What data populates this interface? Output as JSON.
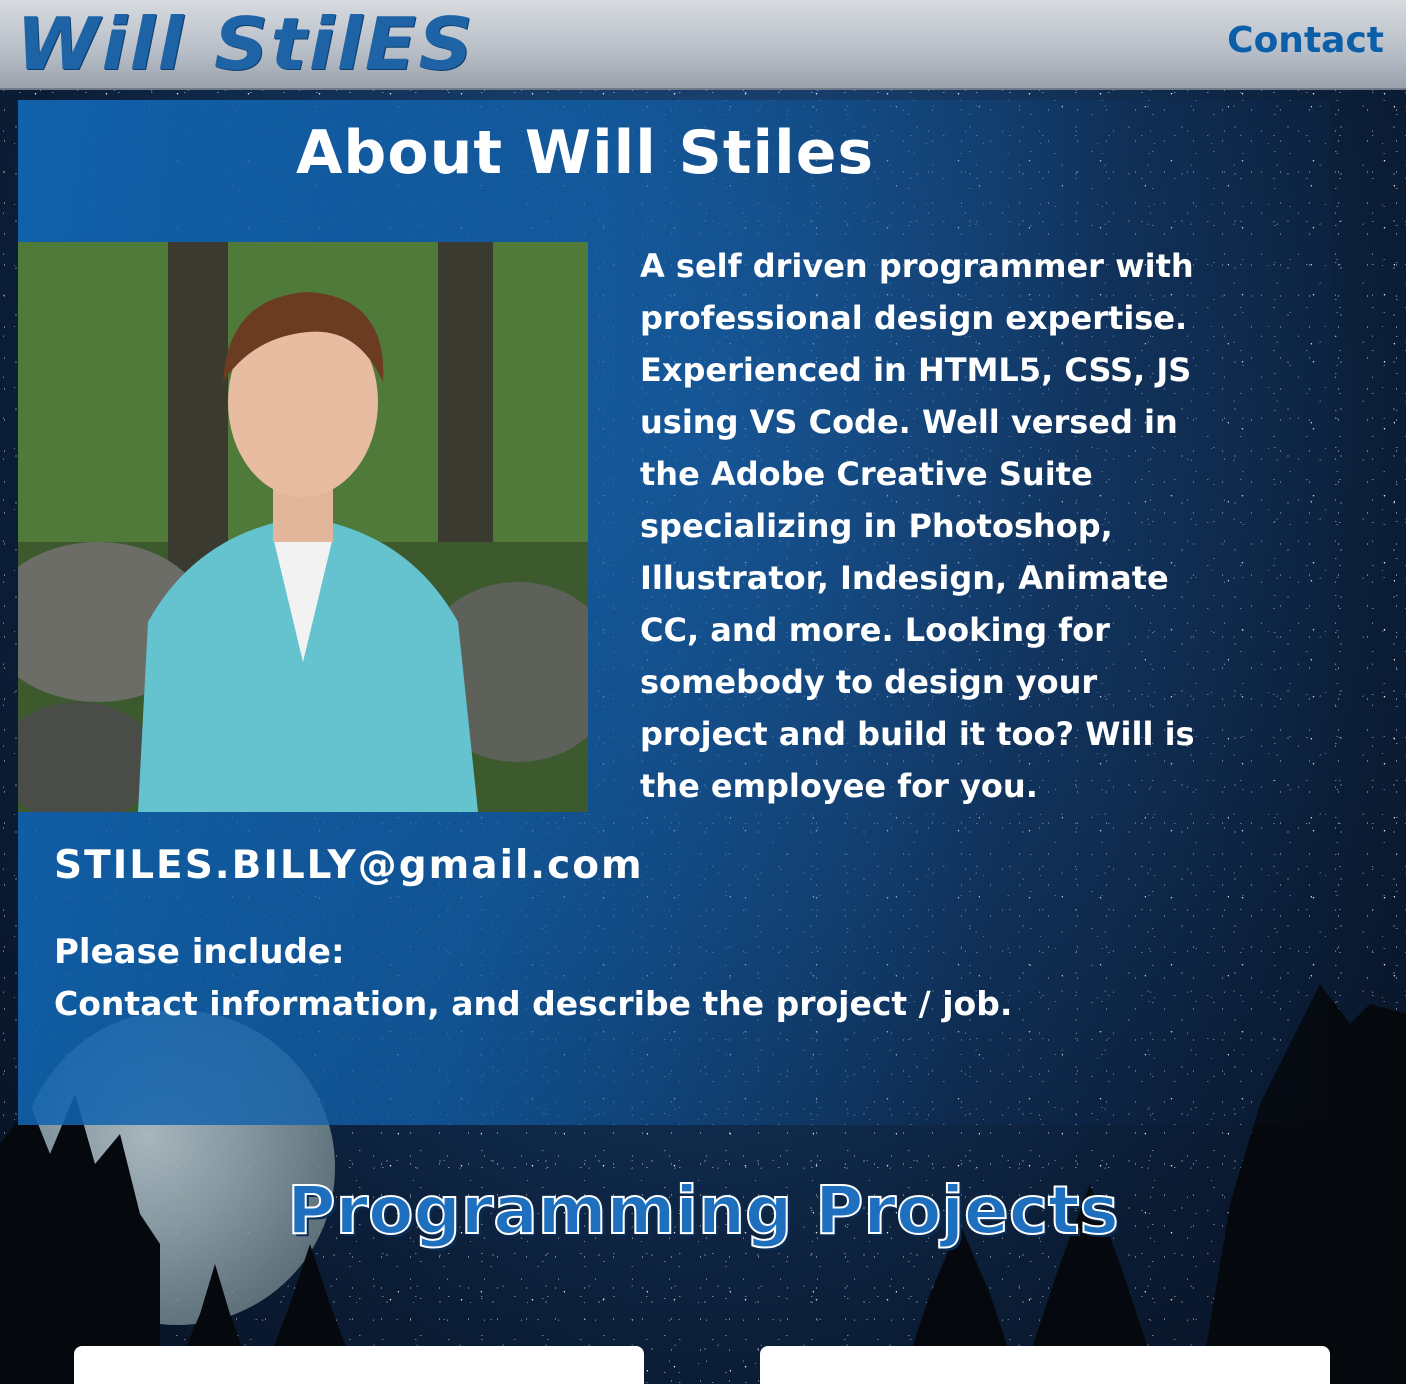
{
  "header": {
    "logo_text": "Will StilES",
    "nav_contact": "Contact"
  },
  "about": {
    "title": "About Will Stiles",
    "photo": "portrait-photo",
    "bio": "A self driven programmer with professional design expertise. Experienced in HTML5, CSS, JS using VS Code. Well versed in the Adobe Creative Suite specializing in Photoshop, Illustrator, Indesign, Animate CC, and more. Looking for somebody to design your project and build it too? Will is the employee for you.",
    "email": "STILES.BILLY@gmail.com",
    "include_label": "Please include:",
    "include_text": "Contact information, and describe the project / job."
  },
  "projects": {
    "title": "Programming Projects"
  },
  "colors": {
    "accent": "#1e63a6",
    "panel": "#1165b2",
    "header_bg": "#c3c8cf"
  }
}
